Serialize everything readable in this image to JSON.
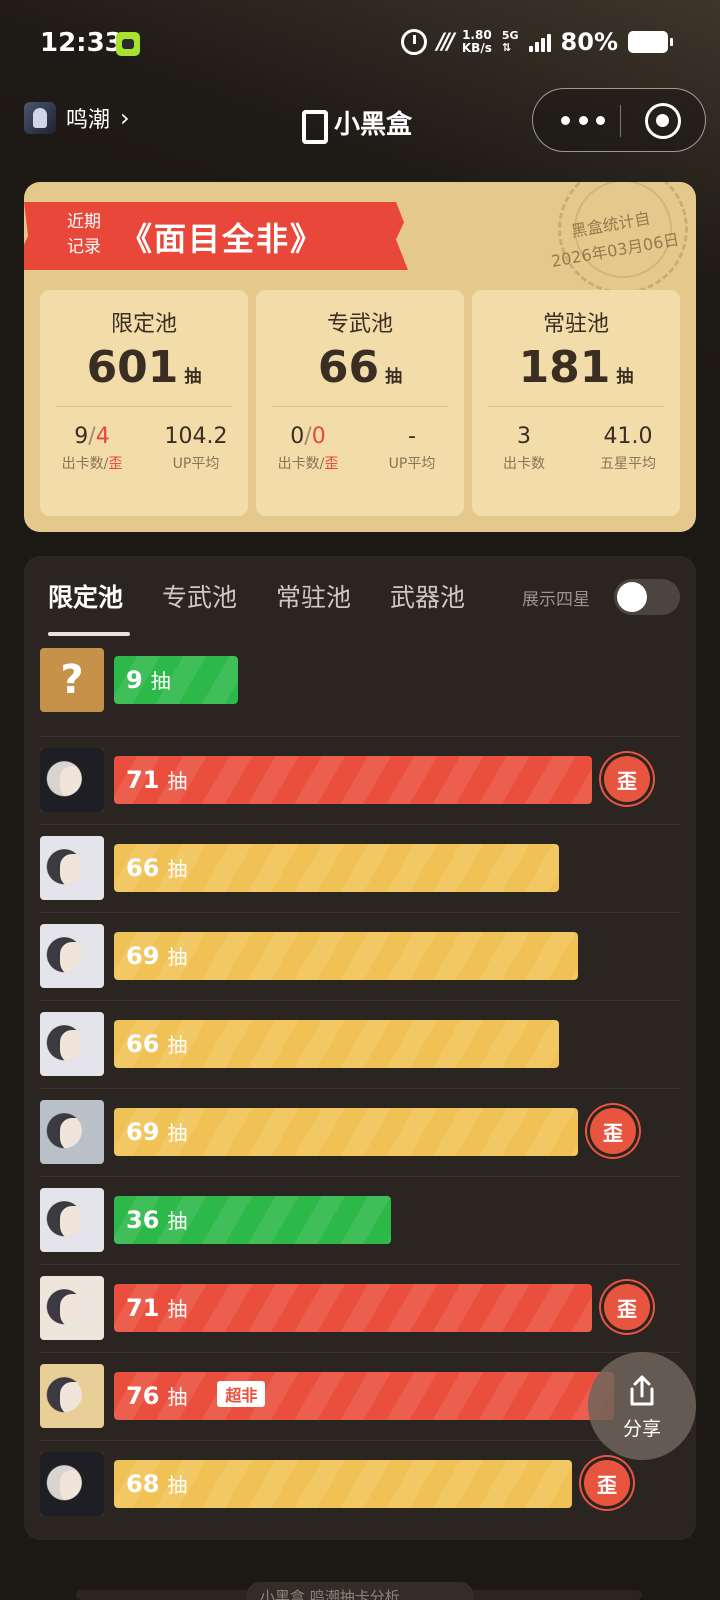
{
  "status_bar": {
    "time": "12:33",
    "network_speed": "1.80",
    "network_unit": "KB/s",
    "network_type": "5G",
    "battery": "80%"
  },
  "nav": {
    "game": "鸣潮",
    "logo_text": "小黑盒"
  },
  "summary": {
    "ribbon_label": "近期记录",
    "title": "《面目全非》",
    "stamp_line1": "黑盒统计自",
    "stamp_line2": "2026年03月06日",
    "pools": [
      {
        "name": "限定池",
        "count": "601",
        "unit": "抽",
        "stat1_value": "9",
        "stat1_sep": "/",
        "stat1_red": "4",
        "stat1_label": "出卡数/",
        "stat1_label_red": "歪",
        "stat2_value": "104.2",
        "stat2_label": "UP平均"
      },
      {
        "name": "专武池",
        "count": "66",
        "unit": "抽",
        "stat1_value": "0",
        "stat1_sep": "/",
        "stat1_red": "0",
        "stat1_label": "出卡数/",
        "stat1_label_red": "歪",
        "stat2_value": "-",
        "stat2_label": "UP平均"
      },
      {
        "name": "常驻池",
        "count": "181",
        "unit": "抽",
        "stat1_value": "3",
        "stat1_sep": "",
        "stat1_red": "",
        "stat1_label": "出卡数",
        "stat1_label_red": "",
        "stat2_value": "41.0",
        "stat2_label": "五星平均"
      }
    ]
  },
  "history": {
    "tabs": [
      "限定池",
      "专武池",
      "常驻池",
      "武器池"
    ],
    "active_tab": 0,
    "show_four_star_label": "展示四星",
    "show_four_star": false,
    "unit": "抽",
    "off_banner_badge": "歪",
    "rows": [
      {
        "pulls": "9",
        "color": "green",
        "avatar": "unknown",
        "avatar_text": "?",
        "off_banner": false,
        "tag": "",
        "fill": 0.247
      },
      {
        "pulls": "71",
        "color": "red",
        "avatar": "dark-hair-character",
        "off_banner": true,
        "tag": "",
        "fill": 0.956
      },
      {
        "pulls": "66",
        "color": "yellow",
        "avatar": "white-hair-character",
        "off_banner": false,
        "tag": "",
        "fill": 0.89
      },
      {
        "pulls": "69",
        "color": "yellow",
        "avatar": "white-hair-character",
        "off_banner": false,
        "tag": "",
        "fill": 0.927
      },
      {
        "pulls": "66",
        "color": "yellow",
        "avatar": "white-hair-character",
        "off_banner": false,
        "tag": "",
        "fill": 0.89
      },
      {
        "pulls": "69",
        "color": "yellow",
        "avatar": "silver-hair-character",
        "off_banner": true,
        "tag": "",
        "fill": 0.927
      },
      {
        "pulls": "36",
        "color": "green",
        "avatar": "white-hair-character",
        "off_banner": false,
        "tag": "",
        "fill": 0.553
      },
      {
        "pulls": "71",
        "color": "red",
        "avatar": "curly-hair-character",
        "off_banner": true,
        "tag": "",
        "fill": 0.956
      },
      {
        "pulls": "76",
        "color": "red",
        "avatar": "blonde-hair-character",
        "off_banner": false,
        "tag": "超非",
        "fill": 1.0
      },
      {
        "pulls": "68",
        "color": "yellow",
        "avatar": "dark-hair-character",
        "off_banner": true,
        "tag": "",
        "fill": 0.915
      }
    ]
  },
  "share": {
    "label": "分享"
  },
  "footer": {
    "text": "小黑盒 鸣潮抽卡分析"
  },
  "colors": {
    "accent_red": "#ea4f3d",
    "accent_yellow": "#f0c255",
    "accent_green": "#2db84a",
    "card_gold": "#e5c98c"
  }
}
